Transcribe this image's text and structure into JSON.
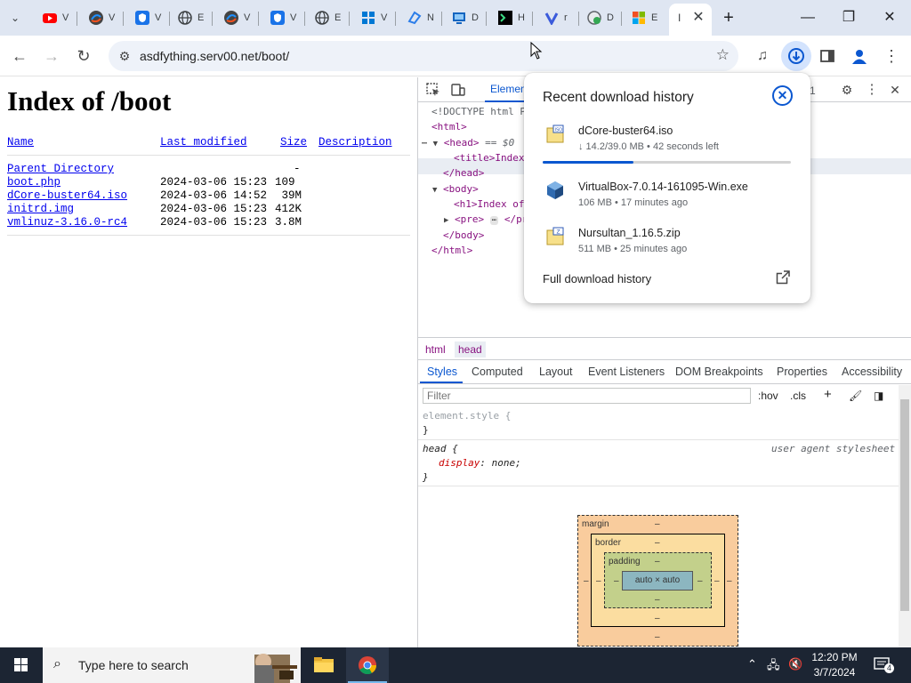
{
  "browser": {
    "tabs": [
      {
        "title": "V",
        "icon": "youtube-icon",
        "color": "#ff0000"
      },
      {
        "title": "V",
        "icon": "edge-dev-icon",
        "color": "#444444"
      },
      {
        "title": "V",
        "icon": "shield-icon",
        "color": "#1a73e8"
      },
      {
        "title": "E",
        "icon": "globe-icon",
        "color": "#3c4043"
      },
      {
        "title": "V",
        "icon": "edge-dev-icon",
        "color": "#444444"
      },
      {
        "title": "V",
        "icon": "shield-icon",
        "color": "#1a73e8"
      },
      {
        "title": "E",
        "icon": "globe-icon",
        "color": "#3c4043"
      },
      {
        "title": "V",
        "icon": "windows-icon",
        "color": "#0078d4"
      },
      {
        "title": "N",
        "icon": "vpn-icon",
        "color": "#2b7de9"
      },
      {
        "title": "D",
        "icon": "desktop-icon",
        "color": "#1565c0"
      },
      {
        "title": "H",
        "icon": "terminal-icon",
        "color": "#000000"
      },
      {
        "title": "r",
        "icon": "v-logo-icon",
        "color": "#3b5bdb"
      },
      {
        "title": "D",
        "icon": "globe-icon",
        "color": "#5f6368"
      },
      {
        "title": "E",
        "icon": "microsoft-icon",
        "color": "#f25022"
      }
    ],
    "active_tab": {
      "title": "I",
      "close": "✕"
    },
    "new_tab": "+",
    "window": {
      "minimize": "—",
      "maximize": "❐",
      "close": "✕"
    },
    "url": "asdfything.serv00.net/boot/",
    "accent": "#0b57d0"
  },
  "page": {
    "title": "Index of /boot",
    "columns": {
      "name": "Name",
      "modified": "Last modified",
      "size": "Size",
      "description": "Description"
    },
    "rows": [
      {
        "name": "Parent Directory",
        "modified": "",
        "size": "-"
      },
      {
        "name": "boot.php",
        "modified": "2024-03-06 15:23",
        "size": "109"
      },
      {
        "name": "dCore-buster64.iso",
        "modified": "2024-03-06 14:52",
        "size": " 39M"
      },
      {
        "name": "initrd.img",
        "modified": "2024-03-06 15:23",
        "size": "412K"
      },
      {
        "name": "vmlinuz-3.16.0-rc4",
        "modified": "2024-03-06 15:23",
        "size": "3.8M"
      }
    ]
  },
  "devtools": {
    "main_tab": "Elemen",
    "issues_count": "1",
    "dom": {
      "doctype": "<!DOCTYPE html P",
      "html_open": "<html>",
      "head_open": "<head>",
      "head_marker": "== $0",
      "title_line": "<title>Index",
      "head_close": "</head>",
      "body_open": "<body>",
      "h1_line": "<h1>Index of",
      "pre_line": "<pre>",
      "pre_close": "</pre",
      "body_close": "</body>",
      "html_close": "</html>"
    },
    "breadcrumbs": [
      "html",
      "head"
    ],
    "subtabs": [
      "Styles",
      "Computed",
      "Layout",
      "Event Listeners",
      "DOM Breakpoints",
      "Properties",
      "Accessibility"
    ],
    "filter_placeholder": "Filter",
    "hov": ":hov",
    "cls": ".cls",
    "rules": {
      "element_style": "element.style {",
      "element_close": "}",
      "head_selector": "head {",
      "head_prop": "display",
      "head_val": "none;",
      "head_close": "}",
      "origin": "user agent stylesheet"
    },
    "box_model": {
      "margin_label": "margin",
      "border_label": "border",
      "padding_label": "padding",
      "dash": "–",
      "content": "auto × auto"
    }
  },
  "downloads": {
    "title": "Recent download history",
    "items": [
      {
        "name": "dCore-buster64.iso",
        "meta": "↓ 14.2/39.0 MB • 42 seconds left",
        "icon": "iso-file-icon",
        "progress": 0.364
      },
      {
        "name": "VirtualBox-7.0.14-161095-Win.exe",
        "meta": "106 MB • 17 minutes ago",
        "icon": "virtualbox-icon"
      },
      {
        "name": "Nursultan_1.16.5.zip",
        "meta": "511 MB • 25 minutes ago",
        "icon": "zip-file-icon"
      }
    ],
    "full_history": "Full download history"
  },
  "taskbar": {
    "search_placeholder": "Type here to search",
    "time": "12:20 PM",
    "date": "3/7/2024",
    "notification_count": "4"
  }
}
